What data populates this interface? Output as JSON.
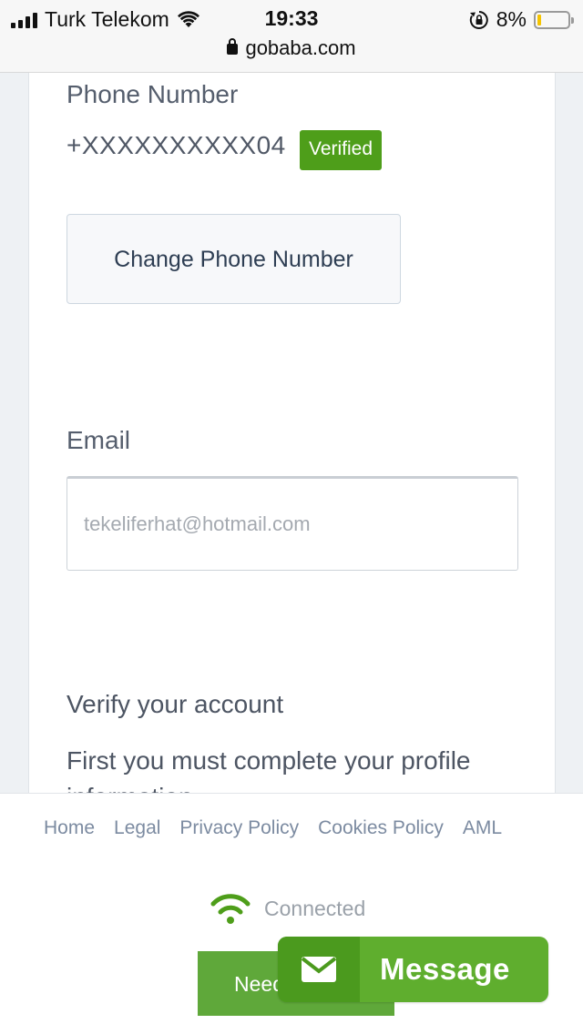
{
  "status_bar": {
    "carrier": "Turk Telekom",
    "time": "19:33",
    "battery_percent": "8%",
    "battery_level": 0.08,
    "url": "gobaba.com"
  },
  "phone": {
    "label": "Phone Number",
    "value": "+XXXXXXXXXX04",
    "badge": "Verified",
    "change_button": "Change Phone Number"
  },
  "email": {
    "label": "Email",
    "placeholder": "tekeliferhat@hotmail.com"
  },
  "verify": {
    "title": "Verify your account",
    "text": "First you must complete your profile information."
  },
  "footer": {
    "links": [
      "Home",
      "Legal",
      "Privacy Policy",
      "Cookies Policy",
      "AML"
    ],
    "connection_status": "Connected",
    "need_button": "Need",
    "message_button": "Message"
  },
  "colors": {
    "accent_green": "#5fae2e",
    "dark_green": "#4b9a1e",
    "verified_green": "#4e9e1a",
    "link_gray": "#7c8ba1"
  }
}
